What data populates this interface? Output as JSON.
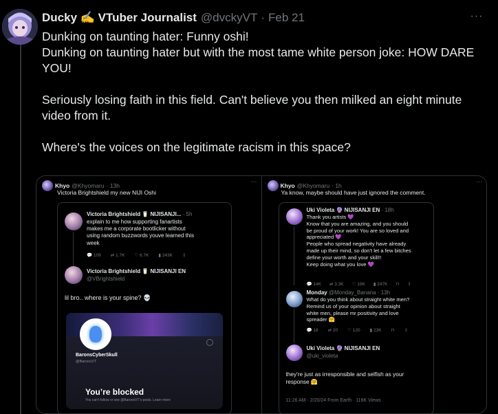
{
  "post": {
    "display_name": "Ducky ✍️ VTuber Journalist",
    "handle": "@dvckyVT",
    "separator": "·",
    "date": "Feb 21",
    "more_icon": "more-horizontal-icon",
    "lines": [
      "Dunking on taunting hater: Funny oshi!",
      "Dunking on taunting hater but with the most tame white person joke: HOW DARE YOU!",
      "",
      "Seriously losing faith in this field. Can't believe you then milked an eight minute video from it.",
      "",
      "Where's the voices on the legitimate racism in this space?"
    ]
  },
  "media": {
    "left": {
      "author": "Khyo",
      "handle": "@Khyomaru",
      "time": "· 13h",
      "text": "Victoria Brightshield my new NIJI Oshi",
      "reply1": {
        "name": "Victoria Brightshield 🥛 NIJISANJI...",
        "time": "· 5h",
        "lines": [
          "explain to me how supporting fanartists",
          "makes me a corporate bootlicker without",
          "using random buzzwords youve learned this",
          "week"
        ],
        "stats": [
          "109",
          "1.7K",
          "6.7K",
          "243K"
        ]
      },
      "reply2": {
        "name": "Victoria Brightshield 🥛 NIJISANJI EN",
        "handle": "@VBrightshield",
        "text": "lil bro.. where is your spine? 💀"
      },
      "card": {
        "name": "BaronsCyberSkull",
        "handle": "@BaronsVT",
        "blocked": "You’re blocked",
        "sub": "You can’t follow or see @BaronsVT’s posts. Learn more"
      }
    },
    "right": {
      "author": "Khyo",
      "handle": "@Khyomaru",
      "time": "· 1h",
      "text": "Ya know, maybe should have just ignored the comment.",
      "uki1": {
        "name": "Uki Violeta 🔮 NIJISANJI EN",
        "time": "· 18h",
        "lines": [
          "Thank you artists 💜",
          "Know that you are amazing, and you should",
          "be proud of your work! You are so loved and",
          "appreciated 💜",
          "People who spread negativity have already",
          "made up their mind, so don't let a few bitches",
          "define your worth and your skill!!",
          "Keep doing what you love 💜"
        ],
        "stats": [
          "14K",
          "3.3K",
          "19K",
          "247K"
        ]
      },
      "monday": {
        "name": "Monday",
        "handle": "@Monday_Banana",
        "time": "· 13h",
        "lines": [
          "What do you think about straight white men?",
          "Remind us of your opinion about straight",
          "white men, please mr positivity and love",
          "spreader 🤗"
        ],
        "stats": [
          "18",
          "20",
          "120",
          "23K"
        ]
      },
      "uki2": {
        "name": "Uki Violeta 🔮 NIJISANJI EN",
        "handle": "@uki_violeta",
        "lines": [
          "they're just as irresponsible and selfish as your",
          "response 🤗"
        ],
        "meta": "11:26 AM · 2/20/24 From Earth · 116K Views"
      }
    }
  }
}
